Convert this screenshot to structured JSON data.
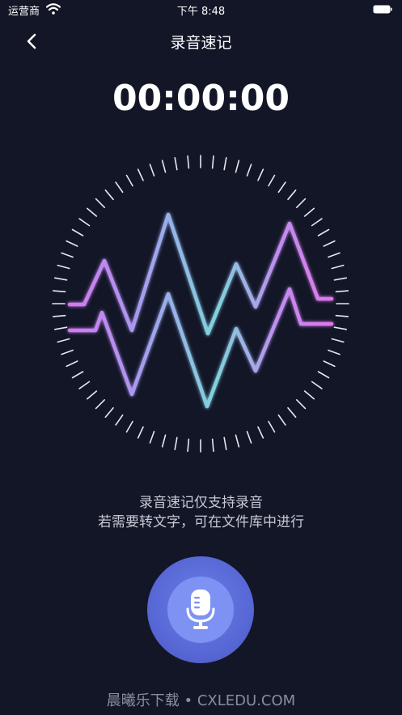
{
  "status_bar": {
    "carrier": "运营商",
    "time": "下午 8:48"
  },
  "nav": {
    "title": "录音速记",
    "back_icon": "chevron-left-icon"
  },
  "timer": {
    "display": "00:00:00"
  },
  "visualizer": {
    "icon": "waveform-icon",
    "colors": {
      "pink": "#e46cf0",
      "purple": "#b48ef0",
      "cyan": "#7fd3dc"
    }
  },
  "hint": {
    "line1": "录音速记仅支持录音",
    "line2": "若需要转文字，可在文件库中进行"
  },
  "record": {
    "icon": "microphone-icon",
    "accent": "#5f70dc"
  },
  "watermark": "晨曦乐下载 • CXLEDU.COM"
}
